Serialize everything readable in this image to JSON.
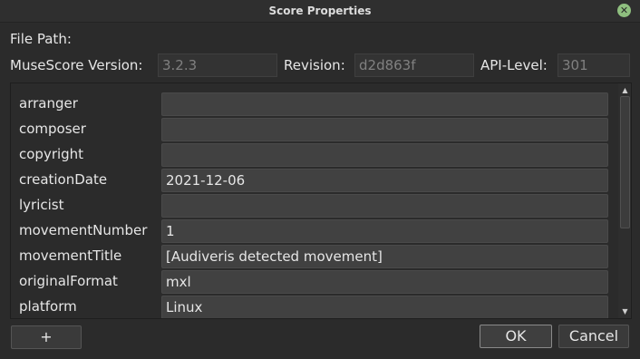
{
  "window": {
    "title": "Score Properties"
  },
  "labels": {
    "file_path": "File Path:",
    "musescore_version": "MuseScore Version:",
    "revision": "Revision:",
    "api_level": "API-Level:"
  },
  "info": {
    "version": "3.2.3",
    "revision": "d2d863f",
    "api_level": "301"
  },
  "properties": [
    {
      "key": "arranger",
      "value": ""
    },
    {
      "key": "composer",
      "value": ""
    },
    {
      "key": "copyright",
      "value": ""
    },
    {
      "key": "creationDate",
      "value": "2021-12-06"
    },
    {
      "key": "lyricist",
      "value": ""
    },
    {
      "key": "movementNumber",
      "value": "1"
    },
    {
      "key": "movementTitle",
      "value": "[Audiveris detected movement]"
    },
    {
      "key": "originalFormat",
      "value": "mxl"
    },
    {
      "key": "platform",
      "value": "Linux"
    }
  ],
  "buttons": {
    "add": "+",
    "ok": "OK",
    "cancel": "Cancel"
  },
  "icons": {
    "close": "close-icon",
    "scroll_up": "chevron-up-icon",
    "scroll_down": "chevron-down-icon"
  }
}
